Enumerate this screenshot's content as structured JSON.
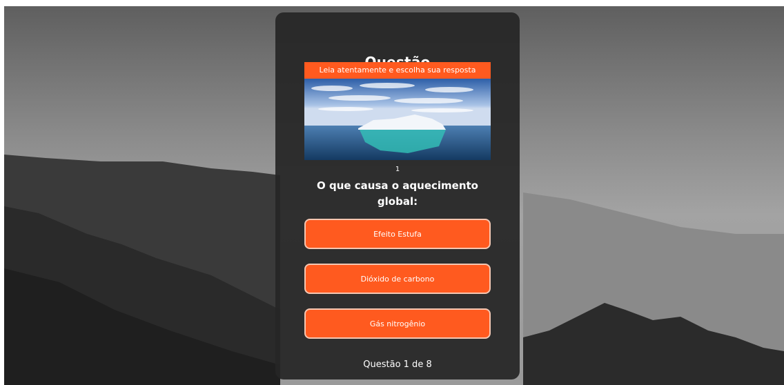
{
  "background": {
    "icon": "mountain-landscape-image"
  },
  "card": {
    "title": "Questão",
    "banner": "Leia atentamente e escolha sua resposta",
    "image_icon": "iceberg-image",
    "question_number": "1",
    "question_text": "O que causa o aquecimento global:",
    "options": [
      {
        "label": "Efeito Estufa"
      },
      {
        "label": "Dióxido de carbono"
      },
      {
        "label": "Gás nitrogênio"
      }
    ],
    "progress": "Questão 1 de 8"
  },
  "colors": {
    "accent": "#ff5a1f",
    "card": "#262626"
  }
}
